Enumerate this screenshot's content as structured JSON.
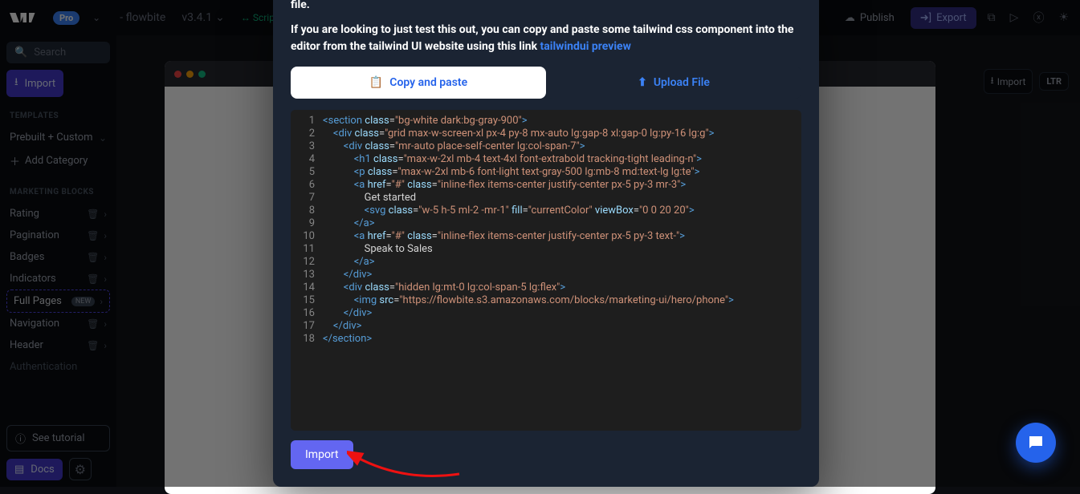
{
  "topbar": {
    "pro": "Pro",
    "project": "- flowbite",
    "version": "v3.4.1",
    "scripts": "Scripts In",
    "publish": "Publish",
    "export": "Export"
  },
  "sidebar": {
    "search": "Search",
    "import": "Import",
    "templates_title": "TEMPLATES",
    "prebuilt": "Prebuilt + Custom",
    "add_category": "Add Category",
    "marketing_title": "MARKETING BLOCKS",
    "items": [
      "Rating",
      "Pagination",
      "Badges",
      "Indicators",
      "Full Pages",
      "Navigation",
      "Header",
      "Authentication"
    ],
    "new_badge": "NEW",
    "tutorial": "See tutorial",
    "docs": "Docs"
  },
  "canvas": {
    "import_label": "Import",
    "ltr": "LTR"
  },
  "modal": {
    "line1_partial": "file.",
    "line2": "If you are looking to just test this out, you can copy and paste some tailwind css component into the editor from the tailwind UI website using this link",
    "link": "tailwindui preview",
    "tab_copy": "Copy and paste",
    "tab_upload": "Upload File",
    "import_btn": "Import"
  },
  "code": {
    "line_count": 18,
    "lines": [
      {
        "indent": 0,
        "type": "open",
        "tag": "section",
        "attrs": [
          [
            "class",
            "bg-white dark:bg-gray-900"
          ]
        ]
      },
      {
        "indent": 1,
        "type": "open",
        "tag": "div",
        "attrs": [
          [
            "class",
            "grid max-w-screen-xl px-4 py-8 mx-auto lg:gap-8 xl:gap-0 lg:py-16 lg:g"
          ]
        ]
      },
      {
        "indent": 2,
        "type": "open",
        "tag": "div",
        "attrs": [
          [
            "class",
            "mr-auto place-self-center lg:col-span-7"
          ]
        ]
      },
      {
        "indent": 3,
        "type": "open",
        "tag": "h1",
        "attrs": [
          [
            "class",
            "max-w-2xl mb-4 text-4xl font-extrabold tracking-tight leading-n"
          ]
        ]
      },
      {
        "indent": 3,
        "type": "open",
        "tag": "p",
        "attrs": [
          [
            "class",
            "max-w-2xl mb-6 font-light text-gray-500 lg:mb-8 md:text-lg lg:te"
          ]
        ]
      },
      {
        "indent": 3,
        "type": "open",
        "tag": "a",
        "attrs": [
          [
            "href",
            "#"
          ],
          [
            "class",
            "inline-flex items-center justify-center px-5 py-3 mr-3"
          ]
        ]
      },
      {
        "indent": 4,
        "type": "text",
        "text": "Get started"
      },
      {
        "indent": 4,
        "type": "open",
        "tag": "svg",
        "attrs": [
          [
            "class",
            "w-5 h-5 ml-2 -mr-1"
          ],
          [
            "fill",
            "currentColor"
          ],
          [
            "viewBox",
            "0 0 20 20"
          ]
        ]
      },
      {
        "indent": 3,
        "type": "close",
        "tag": "a"
      },
      {
        "indent": 3,
        "type": "open",
        "tag": "a",
        "attrs": [
          [
            "href",
            "#"
          ],
          [
            "class",
            "inline-flex items-center justify-center px-5 py-3 text-"
          ]
        ]
      },
      {
        "indent": 4,
        "type": "text",
        "text": "Speak to Sales"
      },
      {
        "indent": 3,
        "type": "close",
        "tag": "a"
      },
      {
        "indent": 2,
        "type": "close",
        "tag": "div"
      },
      {
        "indent": 2,
        "type": "open",
        "tag": "div",
        "attrs": [
          [
            "class",
            "hidden lg:mt-0 lg:col-span-5 lg:flex"
          ]
        ]
      },
      {
        "indent": 3,
        "type": "open",
        "tag": "img",
        "attrs": [
          [
            "src",
            "https://flowbite.s3.amazonaws.com/blocks/marketing-ui/hero/phone"
          ]
        ]
      },
      {
        "indent": 2,
        "type": "close",
        "tag": "div"
      },
      {
        "indent": 1,
        "type": "close",
        "tag": "div"
      },
      {
        "indent": 0,
        "type": "close",
        "tag": "section"
      }
    ]
  }
}
